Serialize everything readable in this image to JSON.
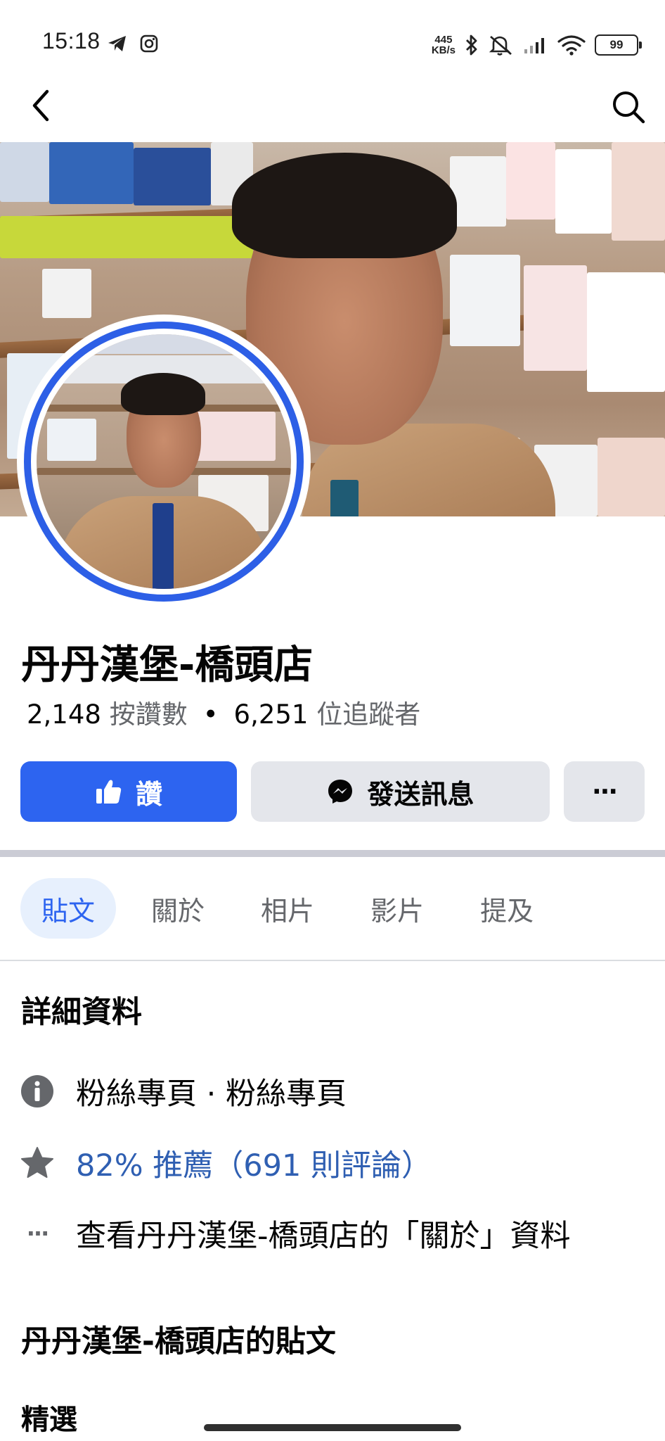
{
  "status_bar": {
    "time": "15:18",
    "net_rate_value": "445",
    "net_rate_unit": "KB/s",
    "battery": "99",
    "icons": [
      "telegram-icon",
      "instagram-icon",
      "bluetooth-icon",
      "mute-icon",
      "signal-icon",
      "wifi-icon",
      "battery-icon"
    ]
  },
  "nav": {
    "back_icon": "back-arrow-icon",
    "search_icon": "search-icon"
  },
  "page": {
    "name": "丹丹漢堡-橋頭店",
    "likes_count": "2,148",
    "likes_label": "按讚數",
    "separator": "•",
    "followers_count": "6,251",
    "followers_label": "位追蹤者"
  },
  "actions": {
    "like_label": "讚",
    "message_label": "發送訊息",
    "more_label": "···"
  },
  "tabs": [
    {
      "label": "貼文",
      "active": true
    },
    {
      "label": "關於",
      "active": false
    },
    {
      "label": "相片",
      "active": false
    },
    {
      "label": "影片",
      "active": false
    },
    {
      "label": "提及",
      "active": false
    }
  ],
  "details": {
    "title": "詳細資料",
    "category": "粉絲專頁 · 粉絲專頁",
    "rating": "82% 推薦（691 則評論）",
    "see_about": "查看丹丹漢堡-橋頭店的「關於」資料",
    "more_glyph": "···"
  },
  "posts": {
    "title": "丹丹漢堡-橋頭店的貼文",
    "featured": "精選"
  },
  "colors": {
    "accent": "#2d64f0",
    "link_blue": "#2f5fb2",
    "secondary_text": "#65676b",
    "button_gray": "#e4e6eb",
    "tab_active_bg": "#e7f0fd"
  }
}
